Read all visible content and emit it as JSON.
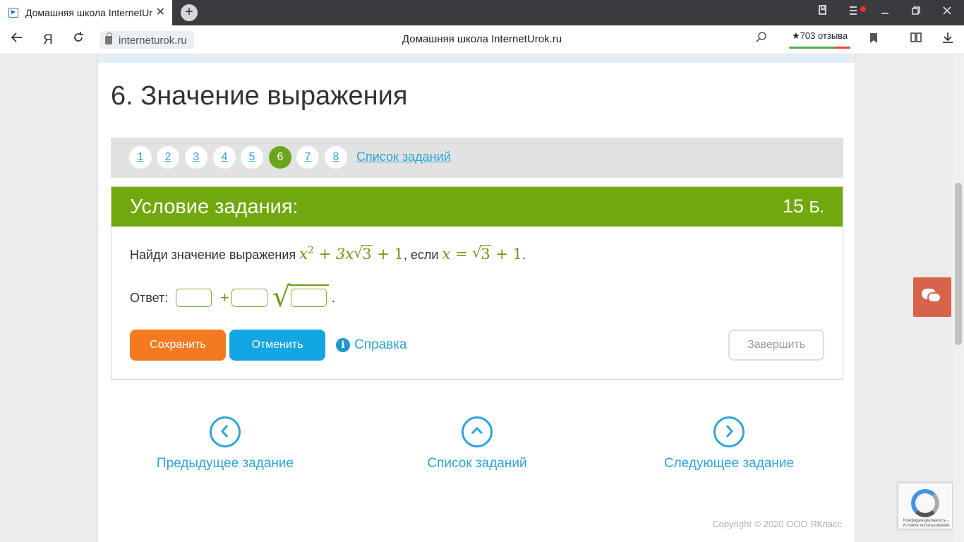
{
  "browser": {
    "tab_title": "Домашняя школа InternetUr",
    "tab_close": "✕",
    "new_tab": "+",
    "url": "interneturok.ru",
    "page_title": "Домашняя школа InternetUrok.ru",
    "reviews": "★703 отзыва",
    "yandex_logo": "Я"
  },
  "page": {
    "heading": "6. Значение выражения",
    "pager": {
      "items": [
        "1",
        "2",
        "3",
        "4",
        "5",
        "6",
        "7",
        "8"
      ],
      "active_index": 5,
      "list_link": "Список заданий"
    },
    "task": {
      "title": "Условие задания:",
      "score_value": "15",
      "score_unit": "Б.",
      "problem_prefix": "Найди значение выражения",
      "problem_if": ", если",
      "expression": {
        "x": "x",
        "exp": "2",
        "plus1": "+",
        "coef": "3x",
        "radicand": "3",
        "plus2": "+",
        "one": "1"
      },
      "condition": {
        "x": "x",
        "eq": "=",
        "radicand": "3",
        "plus": "+",
        "one": "1"
      },
      "period": ".",
      "answer_label": "Ответ:",
      "answer_plus": "+",
      "answer_root": "√",
      "answer_period": ".",
      "save": "Сохранить",
      "cancel": "Отменить",
      "help": "Справка",
      "help_icon": "i",
      "finish": "Завершить"
    },
    "bottom_nav": {
      "prev": "Предыдущее задание",
      "list": "Список заданий",
      "next": "Следующее задание",
      "prev_icon": "‹",
      "list_icon": "ˆ",
      "next_icon": "›"
    },
    "copyright": "Copyright © 2020 ООО ЯКласс",
    "recaptcha": "Конфиденциальность - Условия использования"
  },
  "colors": {
    "accent_green": "#70a80d",
    "link_blue": "#2fa4d6",
    "save_orange": "#f47a20",
    "cancel_blue": "#12a6e3"
  }
}
